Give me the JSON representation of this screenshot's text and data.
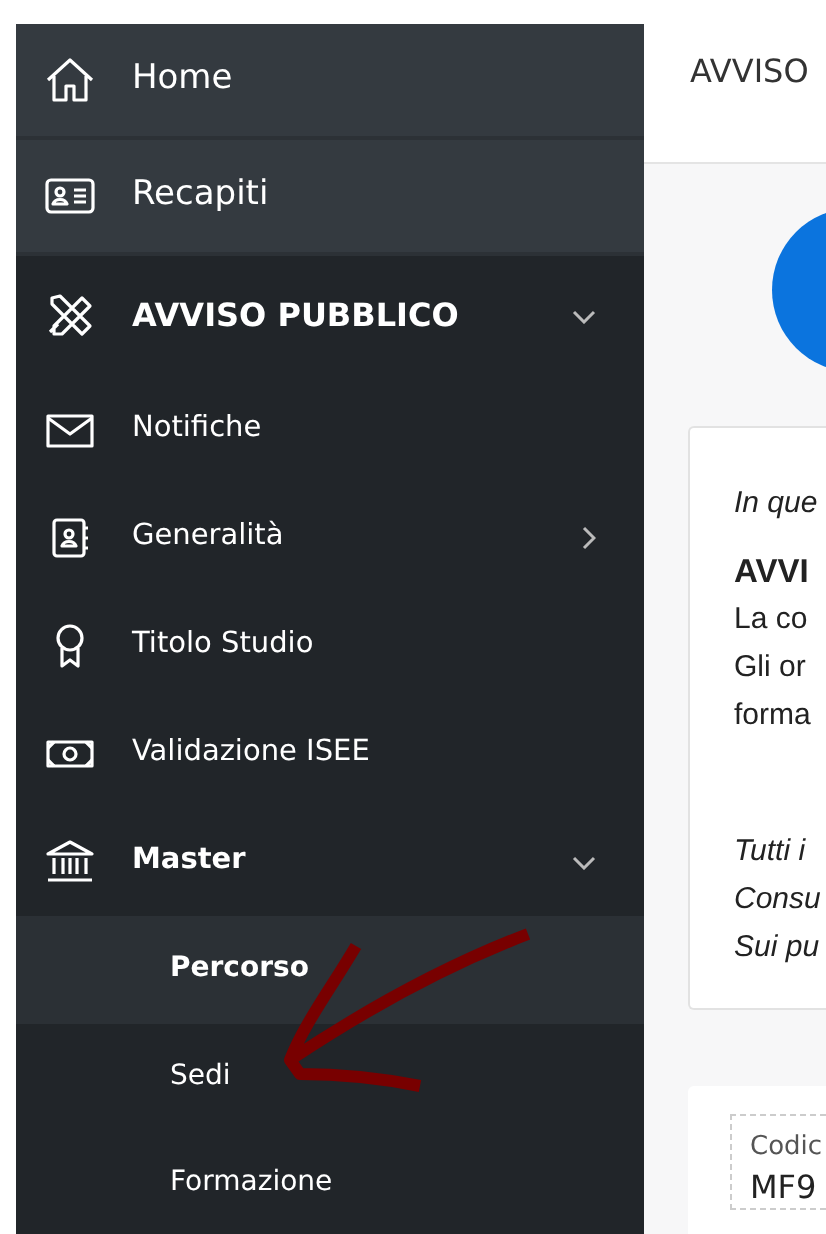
{
  "sidebar": {
    "top_links": [
      {
        "label": "Home"
      },
      {
        "label": "Recapiti"
      }
    ],
    "menu": [
      {
        "label": "AVVISO PUBBLICO",
        "expanded": true,
        "children": [
          {
            "label": "Notifiche"
          },
          {
            "label": "Generalità",
            "expanded": false
          },
          {
            "label": "Titolo Studio"
          },
          {
            "label": "Validazione ISEE"
          },
          {
            "label": "Master",
            "expanded": true,
            "children": [
              {
                "label": "Percorso",
                "selected": true
              },
              {
                "label": "Sedi",
                "selected": false
              },
              {
                "label": "Formazione",
                "selected": false
              }
            ]
          }
        ]
      }
    ]
  },
  "header": {
    "title": "AVVISO"
  },
  "info_card": {
    "lines": [
      {
        "text": "In que",
        "kind": "italic"
      },
      {
        "text": "AVVI",
        "kind": "bold"
      },
      {
        "text": "La co",
        "kind": "plain"
      },
      {
        "text": "Gli or",
        "kind": "plain"
      },
      {
        "text": "forma",
        "kind": "plain"
      },
      {
        "text": "Tutti i",
        "kind": "italic_gap"
      },
      {
        "text": "Consu",
        "kind": "italic"
      },
      {
        "text": "Sui pu",
        "kind": "italic"
      }
    ]
  },
  "code_field": {
    "label": "Codic",
    "value": "MF9"
  }
}
